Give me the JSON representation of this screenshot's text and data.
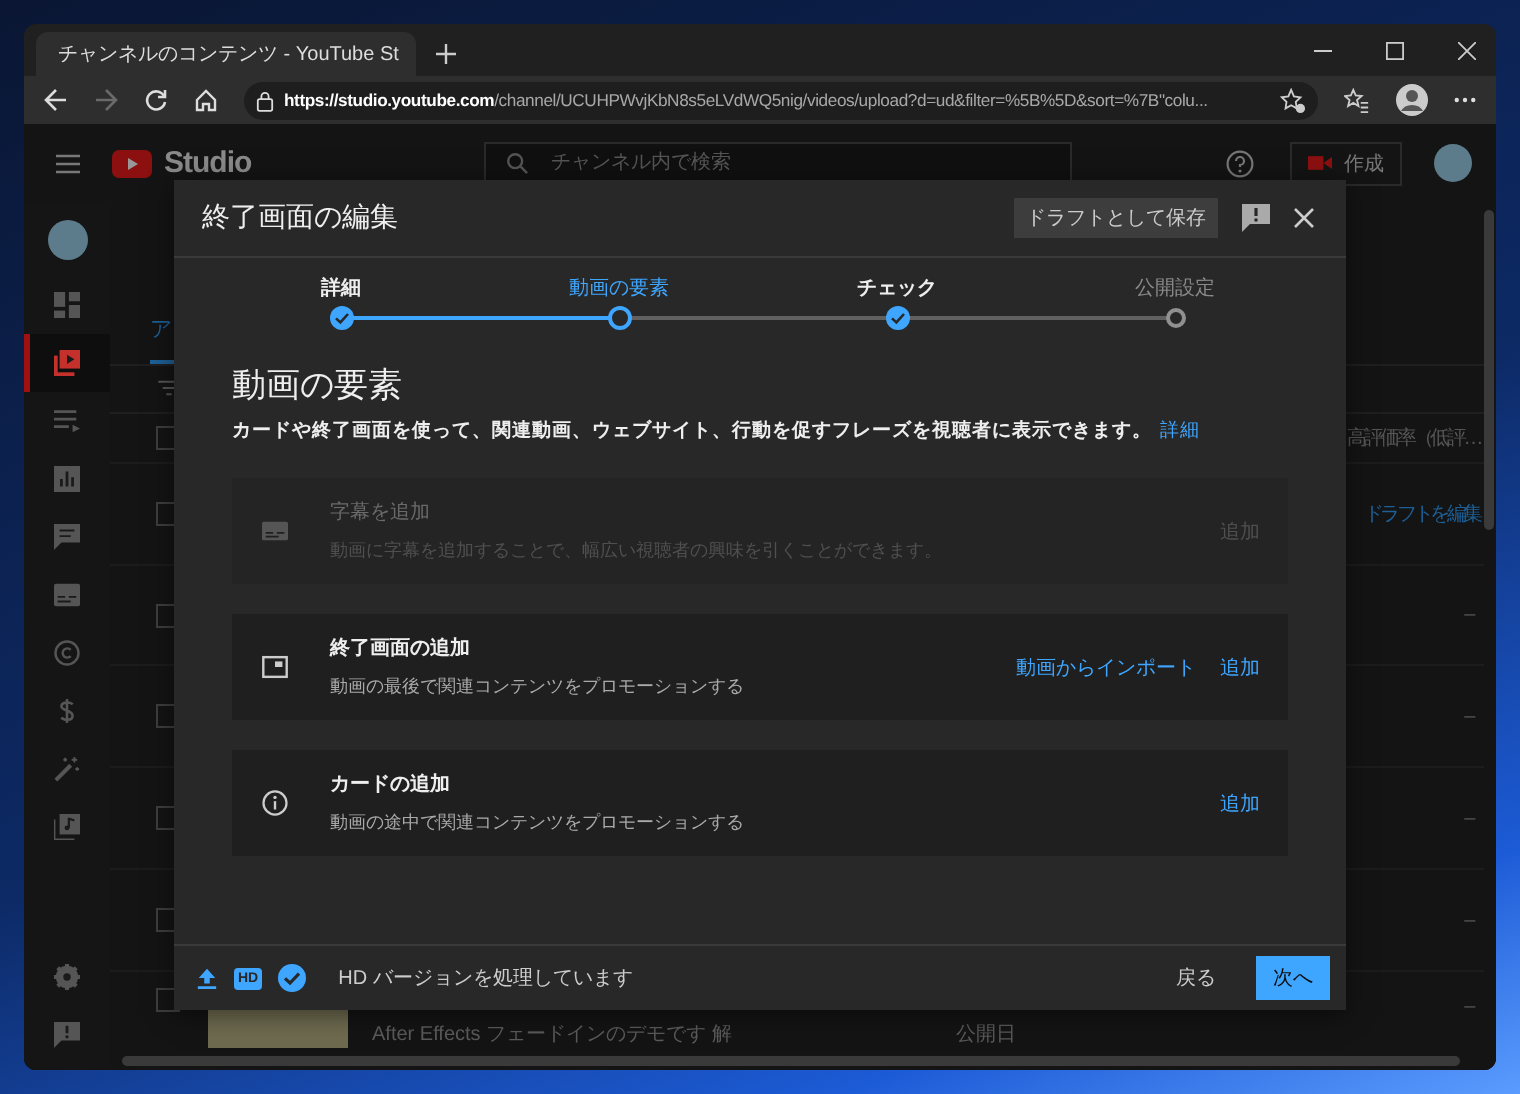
{
  "browser": {
    "tab_title": "チャンネルのコンテンツ - YouTube St",
    "url": "**https://studio.youtube.com**/channel/UCUHPWvjKbN8s5eLVdWQ5nig/videos/upload?d=ud&filter=%5B%5D&sort=%7B\"colu...",
    "forward_disabled": true
  },
  "studio": {
    "logo": "Studio",
    "search_placeholder": "チャンネル内で検索",
    "create_label": "作成"
  },
  "sidebar": {
    "items": [
      {
        "selected": false
      },
      {
        "selected": true
      },
      {
        "selected": false
      },
      {
        "selected": false
      },
      {
        "selected": false
      },
      {
        "selected": false
      },
      {
        "selected": false
      },
      {
        "selected": false
      },
      {
        "selected": false
      },
      {
        "selected": false
      }
    ]
  },
  "background": {
    "tab": "ア",
    "header_right": "高評価率（低評…",
    "select_all_checked": false,
    "rows": [
      {
        "right": "ドラフトを編集",
        "kind": "link",
        "checked": false
      },
      {
        "right": "–",
        "kind": "text",
        "checked": false
      },
      {
        "right": "–",
        "kind": "text",
        "checked": false
      },
      {
        "right": "–",
        "kind": "text",
        "checked": false
      },
      {
        "right": "–",
        "kind": "text",
        "checked": false
      }
    ],
    "last_row": {
      "title": "After Effects フェードインのデモです 解",
      "date_label": "公開日",
      "right": "–",
      "checked": false
    }
  },
  "modal": {
    "title": "終了画面の編集",
    "save_draft": "ドラフトとして保存",
    "steps": [
      {
        "label": "詳細",
        "completed": true,
        "selected": false
      },
      {
        "label": "動画の要素",
        "completed": false,
        "selected": true
      },
      {
        "label": "チェック",
        "completed": true,
        "selected": false
      },
      {
        "label": "公開設定",
        "completed": false,
        "selected": false
      }
    ],
    "heading": "動画の要素",
    "description": "カードや終了画面を使って、関連動画、ウェブサイト、行動を促すフレーズを視聴者に表示できます。",
    "description_link": "詳細",
    "cards": [
      {
        "title": "字幕を追加",
        "description": "動画に字幕を追加することで、幅広い視聴者の興味を引くことができます。",
        "disabled": true,
        "actions": [
          "追加"
        ]
      },
      {
        "title": "終了画面の追加",
        "description": "動画の最後で関連コンテンツをプロモーションする",
        "disabled": false,
        "actions": [
          "動画からインポート",
          "追加"
        ]
      },
      {
        "title": "カードの追加",
        "description": "動画の途中で関連コンテンツをプロモーションする",
        "disabled": false,
        "actions": [
          "追加"
        ]
      }
    ],
    "footer": {
      "hd_badge": "HD",
      "status": "HD バージョンを処理しています",
      "back": "戻る",
      "next": "次へ"
    }
  }
}
